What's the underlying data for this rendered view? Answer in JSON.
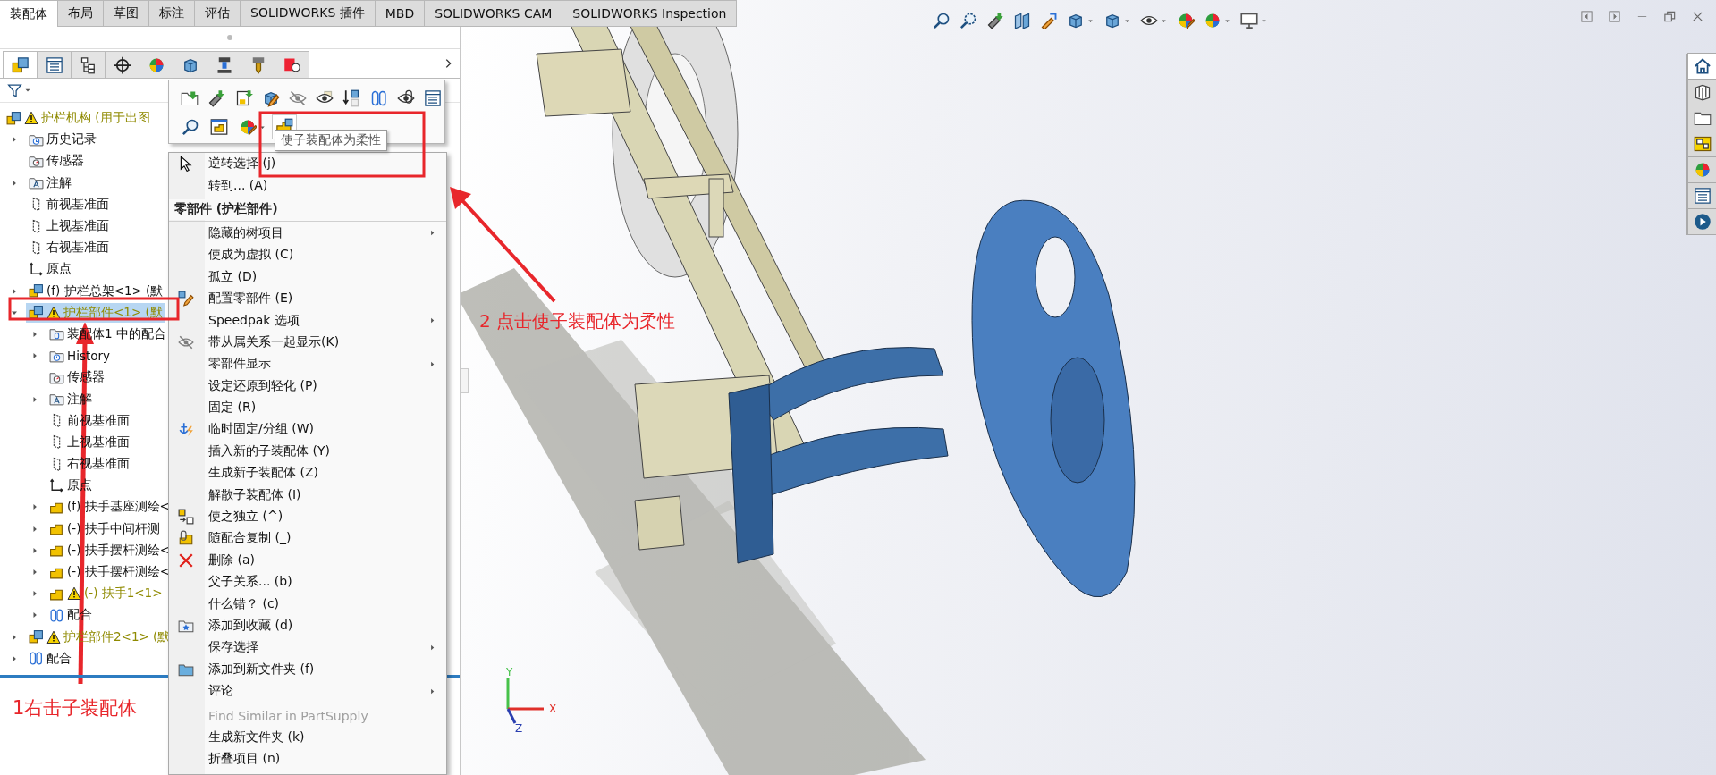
{
  "window_tabs": [
    {
      "label": "装配体",
      "selected": true
    },
    {
      "label": "布局",
      "selected": false
    },
    {
      "label": "草图",
      "selected": false
    },
    {
      "label": "标注",
      "selected": false
    },
    {
      "label": "评估",
      "selected": false
    },
    {
      "label": "SOLIDWORKS 插件",
      "selected": false
    },
    {
      "label": "MBD",
      "selected": false
    },
    {
      "label": "SOLIDWORKS CAM",
      "selected": false
    },
    {
      "label": "SOLIDWORKS Inspection",
      "selected": false
    }
  ],
  "panel_tabs": [
    {
      "kind": "assembly",
      "selected": true
    },
    {
      "kind": "property",
      "selected": false
    },
    {
      "kind": "config",
      "selected": false
    },
    {
      "kind": "crosshair",
      "selected": false
    },
    {
      "kind": "colorball",
      "selected": false
    },
    {
      "kind": "displaycube",
      "selected": false
    },
    {
      "kind": "camtool",
      "selected": false
    },
    {
      "kind": "milltool",
      "selected": false
    },
    {
      "kind": "inspection",
      "selected": false
    }
  ],
  "tree": [
    {
      "label": "护栏机构 (用于出图",
      "kind": "assembly",
      "warning": true,
      "selected": false,
      "children": [
        {
          "label": "历史记录",
          "kind": "history",
          "warning": false,
          "expanded": false,
          "selected": false
        },
        {
          "label": "传感器",
          "kind": "sensor",
          "warning": false,
          "selected": false
        },
        {
          "label": "注解",
          "kind": "annotation",
          "warning": false,
          "expanded": false,
          "selected": false
        },
        {
          "label": "前视基准面",
          "kind": "plane",
          "warning": false,
          "selected": false
        },
        {
          "label": "上视基准面",
          "kind": "plane",
          "warning": false,
          "selected": false
        },
        {
          "label": "右视基准面",
          "kind": "plane",
          "warning": false,
          "selected": false
        },
        {
          "label": "原点",
          "kind": "origin",
          "warning": false,
          "selected": false
        },
        {
          "label": "(f) 护栏总架<1> (默",
          "kind": "assembly",
          "warning": false,
          "expanded": false,
          "selected": false
        },
        {
          "label": "护栏部件<1> (默",
          "kind": "assembly",
          "warning": true,
          "expanded": true,
          "selected": true,
          "children": [
            {
              "label": "装配体1 中的配合",
              "kind": "matefolder",
              "warning": false,
              "expanded": false,
              "selected": false
            },
            {
              "label": "History",
              "kind": "history",
              "warning": false,
              "expanded": false,
              "selected": false
            },
            {
              "label": "传感器",
              "kind": "sensor",
              "warning": false,
              "selected": false
            },
            {
              "label": "注解",
              "kind": "annotation",
              "warning": false,
              "expanded": false,
              "selected": false
            },
            {
              "label": "前视基准面",
              "kind": "plane",
              "warning": false,
              "selected": false
            },
            {
              "label": "上视基准面",
              "kind": "plane",
              "warning": false,
              "selected": false
            },
            {
              "label": "右视基准面",
              "kind": "plane",
              "warning": false,
              "selected": false
            },
            {
              "label": "原点",
              "kind": "origin",
              "warning": false,
              "selected": false
            },
            {
              "label": "(f) 扶手基座测绘<",
              "kind": "part",
              "warning": false,
              "expanded": false,
              "selected": false
            },
            {
              "label": "(-) 扶手中间杆测",
              "kind": "part",
              "warning": false,
              "expanded": false,
              "selected": false
            },
            {
              "label": "(-) 扶手摆杆测绘<",
              "kind": "part",
              "warning": false,
              "expanded": false,
              "selected": false
            },
            {
              "label": "(-) 扶手摆杆测绘<",
              "kind": "part",
              "warning": false,
              "expanded": false,
              "selected": false
            },
            {
              "label": "(-) 扶手1<1>",
              "kind": "part",
              "warning": true,
              "expanded": false,
              "selected": false
            },
            {
              "label": "配合",
              "kind": "mates",
              "warning": false,
              "expanded": false,
              "selected": false
            }
          ]
        },
        {
          "label": "护栏部件2<1> (默",
          "kind": "assembly",
          "warning": true,
          "expanded": false,
          "selected": false
        },
        {
          "label": "配合",
          "kind": "mates",
          "warning": false,
          "expanded": false,
          "selected": false
        }
      ]
    }
  ],
  "popup_toolbar": {
    "rows": [
      [
        {
          "kind": "openfolder",
          "highlighted": false
        },
        {
          "kind": "flashlight",
          "highlighted": false
        },
        {
          "kind": "docarrow",
          "highlighted": false
        },
        {
          "kind": "partpencil",
          "highlighted": false
        },
        {
          "kind": "eyeslash",
          "highlighted": false
        },
        {
          "kind": "eyeblocks",
          "highlighted": false
        },
        {
          "kind": "downcube",
          "highlighted": false
        },
        {
          "kind": "paperclip",
          "highlighted": false
        },
        {
          "kind": "eyeclip",
          "highlighted": false
        },
        {
          "kind": "list",
          "highlighted": false
        }
      ],
      [
        {
          "kind": "magnifier",
          "highlighted": false
        },
        {
          "kind": "windowpart",
          "highlighted": false
        },
        {
          "kind": "colorpencil",
          "highlighted": false
        },
        {
          "kind": "flexpart",
          "highlighted": true
        }
      ]
    ],
    "tooltip": "使子装配体为柔性"
  },
  "context_menu": [
    {
      "kind": "item",
      "label": "逆转选择 (j)",
      "submenu": false,
      "disabled": false
    },
    {
      "kind": "item",
      "label": "转到... (A)",
      "submenu": false,
      "disabled": false
    },
    {
      "kind": "separator"
    },
    {
      "kind": "header",
      "label": "零部件 (护栏部件)"
    },
    {
      "kind": "separator"
    },
    {
      "kind": "item",
      "label": "隐藏的树项目",
      "submenu": true,
      "disabled": false
    },
    {
      "kind": "item",
      "label": "使成为虚拟 (C)",
      "submenu": false,
      "disabled": false
    },
    {
      "kind": "item",
      "label": "孤立 (D)",
      "submenu": false,
      "disabled": false
    },
    {
      "kind": "item",
      "label": "配置零部件 (E)",
      "submenu": false,
      "disabled": false
    },
    {
      "kind": "item",
      "label": "Speedpak 选项",
      "submenu": true,
      "disabled": false
    },
    {
      "kind": "item",
      "label": "带从属关系一起显示(K)",
      "submenu": false,
      "disabled": false
    },
    {
      "kind": "item",
      "label": "零部件显示",
      "submenu": true,
      "disabled": false
    },
    {
      "kind": "item",
      "label": "设定还原到轻化 (P)",
      "submenu": false,
      "disabled": false
    },
    {
      "kind": "item",
      "label": "固定 (R)",
      "submenu": false,
      "disabled": false
    },
    {
      "kind": "item",
      "label": "临时固定/分组 (W)",
      "submenu": false,
      "disabled": false
    },
    {
      "kind": "item",
      "label": "插入新的子装配体 (Y)",
      "submenu": false,
      "disabled": false
    },
    {
      "kind": "item",
      "label": "生成新子装配体 (Z)",
      "submenu": false,
      "disabled": false
    },
    {
      "kind": "item",
      "label": "解散子装配体 (I)",
      "submenu": false,
      "disabled": false
    },
    {
      "kind": "item",
      "label": "使之独立 (^)",
      "submenu": false,
      "disabled": false
    },
    {
      "kind": "item",
      "label": "随配合复制 (_)",
      "submenu": false,
      "disabled": false
    },
    {
      "kind": "item",
      "label": "删除 (a)",
      "submenu": false,
      "disabled": false
    },
    {
      "kind": "item",
      "label": "父子关系... (b)",
      "submenu": false,
      "disabled": false
    },
    {
      "kind": "item",
      "label": "什么错？ (c)",
      "submenu": false,
      "disabled": false
    },
    {
      "kind": "item",
      "label": "添加到收藏 (d)",
      "submenu": false,
      "disabled": false
    },
    {
      "kind": "item",
      "label": "保存选择",
      "submenu": true,
      "disabled": false
    },
    {
      "kind": "item",
      "label": "添加到新文件夹 (f)",
      "submenu": false,
      "disabled": false
    },
    {
      "kind": "item",
      "label": "评论",
      "submenu": true,
      "disabled": false
    },
    {
      "kind": "separator"
    },
    {
      "kind": "item",
      "label": "Find Similar in PartSupply",
      "submenu": false,
      "disabled": true
    },
    {
      "kind": "item",
      "label": "生成新文件夹 (k)",
      "submenu": false,
      "disabled": false
    },
    {
      "kind": "item",
      "label": "折叠项目 (n)",
      "submenu": false,
      "disabled": false
    }
  ],
  "task_pane": [
    {
      "kind": "home",
      "selected": true
    },
    {
      "kind": "cubestack",
      "selected": false
    },
    {
      "kind": "openfolder2",
      "selected": false
    },
    {
      "kind": "library",
      "selected": false
    },
    {
      "kind": "colorball",
      "selected": false
    },
    {
      "kind": "list",
      "selected": false
    },
    {
      "kind": "playcircle",
      "selected": false
    }
  ],
  "triad": {
    "axes": [
      {
        "kind": "y",
        "label": "Y"
      },
      {
        "kind": "x",
        "label": "X"
      },
      {
        "kind": "z",
        "label": "Z"
      }
    ]
  },
  "annotations": [
    {
      "kind": "step-one",
      "text": "1右击子装配体"
    },
    {
      "kind": "step-two",
      "text": "2 点击使子装配体为柔性"
    }
  ]
}
